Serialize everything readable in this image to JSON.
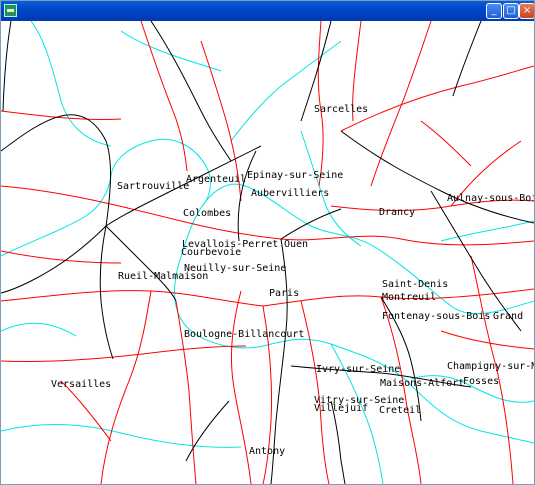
{
  "window": {
    "title": "",
    "minimize_glyph": "_",
    "maximize_glyph": "□",
    "close_glyph": "×"
  },
  "colors": {
    "roads": "#ff0000",
    "rail": "#000000",
    "water": "#00e5e5",
    "background": "#ffffff"
  },
  "map": {
    "labels": [
      "Sarcelles",
      "Epinay-sur-Seine",
      "Argenteuil",
      "Aubervilliers",
      "Sartrouville",
      "Aulnay-sous-Bois",
      "Colombes",
      "Drancy",
      "Levallois-Perret",
      "Courbevoie",
      "Ouen",
      "Neuilly-sur-Seine",
      "Rueil-Malmaison",
      "Saint-Denis",
      "Montreuil",
      "Paris",
      "Fontenay-sous-Bois",
      "Grand",
      "Boulogne-Billancourt",
      "Champigny-sur-Ma",
      "Ivry-sur-Seine",
      "Versailles",
      "Maisons-Alfort",
      "Fosses",
      "Vitry-sur-Seine",
      "Villejuif",
      "Creteil",
      "Antony"
    ]
  }
}
